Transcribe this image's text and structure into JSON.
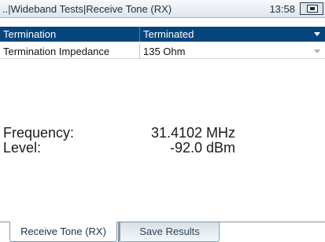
{
  "titlebar": {
    "path": "..|Wideband Tests|Receive Tone (RX)",
    "clock": "13:58",
    "status_icon": "screen-capture-icon"
  },
  "settings": [
    {
      "label": "Termination",
      "value": "Terminated",
      "selected": true
    },
    {
      "label": "Termination Impedance",
      "value": "135 Ohm",
      "selected": false
    }
  ],
  "measurements": {
    "frequency": {
      "label": "Frequency:",
      "value": "31.4102 MHz"
    },
    "level": {
      "label": "Level:",
      "value": "-92.0 dBm"
    }
  },
  "tabs": [
    {
      "label": "Receive Tone (RX)",
      "active": true
    },
    {
      "label": "Save Results",
      "active": false
    }
  ],
  "colors": {
    "selected_row": "#06467d",
    "titlebar": "#dde5ec",
    "tab_inactive": "#d8e1e8"
  }
}
